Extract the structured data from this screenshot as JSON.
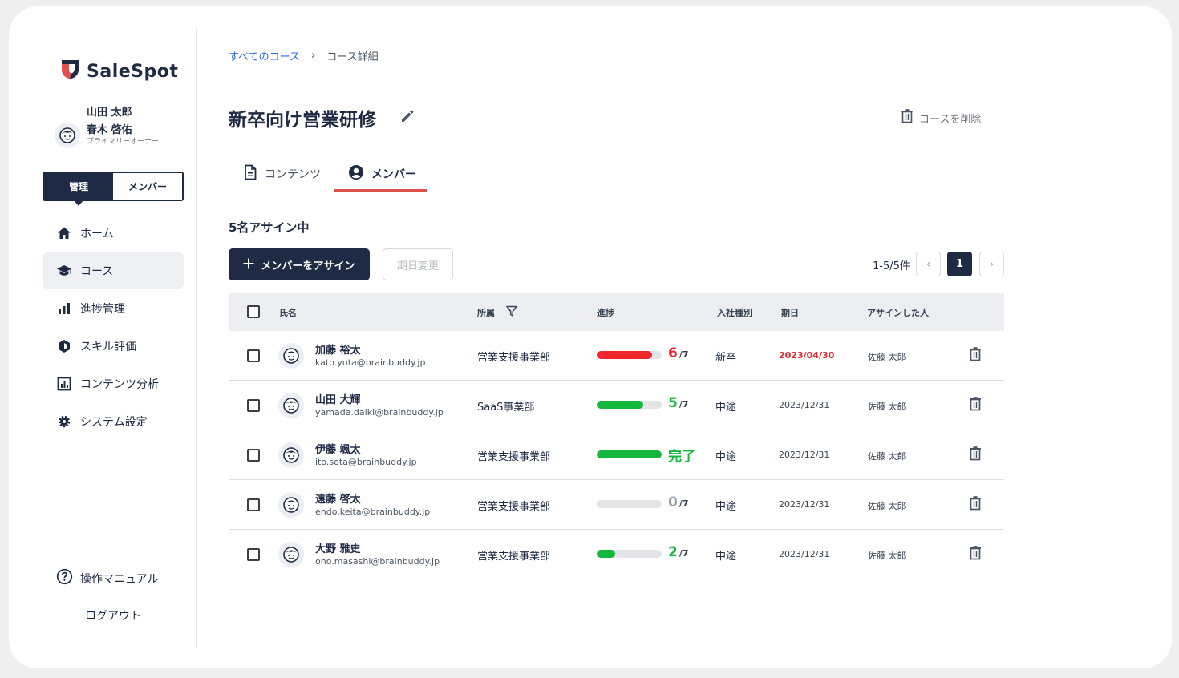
{
  "app": {
    "logo_text": "SaleSpot"
  },
  "sidebar": {
    "org_name": "山田 太郎",
    "user_name": "春木 啓佑",
    "user_role": "プライマリーオーナー",
    "role_toggle": {
      "admin": "管理",
      "member": "メンバー",
      "active": "admin"
    },
    "nav": [
      {
        "label": "ホーム",
        "icon": "home-icon"
      },
      {
        "label": "コース",
        "icon": "graduation-cap-icon",
        "active": true
      },
      {
        "label": "進捗管理",
        "icon": "bar-chart-icon"
      },
      {
        "label": "スキル評価",
        "icon": "skill-icon"
      },
      {
        "label": "コンテンツ分析",
        "icon": "analytics-icon"
      },
      {
        "label": "システム設定",
        "icon": "gear-icon"
      }
    ],
    "help_label": "操作マニュアル",
    "logout_label": "ログアウト"
  },
  "breadcrumb": {
    "link": "すべてのコース",
    "separator": "›",
    "current": "コース詳細"
  },
  "page": {
    "title": "新卒向け営業研修",
    "delete_label": "コースを削除"
  },
  "tabs": [
    {
      "label": "コンテンツ",
      "icon": "document-icon"
    },
    {
      "label": "メンバー",
      "icon": "user-circle-icon",
      "active": true
    }
  ],
  "members": {
    "assign_count": "5名アサイン中",
    "assign_button": "メンバーをアサイン",
    "change_date_button": "期日変更",
    "pager_label": "1-5/5件",
    "current_page": "1",
    "columns": {
      "name": "氏名",
      "dept": "所属",
      "progress": "進捗",
      "type": "入社種別",
      "due": "期日",
      "assigner": "アサインした人"
    },
    "rows": [
      {
        "name": "加藤 裕太",
        "email": "kato.yuta@brainbuddy.jp",
        "dept": "営業支援事業部",
        "done": "6",
        "total": "/7",
        "progress": 0.857,
        "status_color": "#f0262c",
        "type": "新卒",
        "due": "2023/04/30",
        "overdue": true,
        "assigner": "佐藤 太郎"
      },
      {
        "name": "山田 大輝",
        "email": "yamada.daiki@brainbuddy.jp",
        "dept": "SaaS事業部",
        "done": "5",
        "total": "/7",
        "progress": 0.714,
        "status_color": "#13b83a",
        "type": "中途",
        "due": "2023/12/31",
        "overdue": false,
        "assigner": "佐藤 太郎"
      },
      {
        "name": "伊藤 颯太",
        "email": "ito.sota@brainbuddy.jp",
        "dept": "営業支援事業部",
        "done": "完了",
        "total": "",
        "progress": 1.0,
        "status_color": "#13b83a",
        "type": "中途",
        "due": "2023/12/31",
        "overdue": false,
        "assigner": "佐藤 太郎"
      },
      {
        "name": "遠藤 啓太",
        "email": "endo.keita@brainbuddy.jp",
        "dept": "営業支援事業部",
        "done": "0",
        "total": "/7",
        "progress": 0.0,
        "status_color": "#9aa0aa",
        "type": "中途",
        "due": "2023/12/31",
        "overdue": false,
        "assigner": "佐藤 太郎"
      },
      {
        "name": "大野 雅史",
        "email": "ono.masashi@brainbuddy.jp",
        "dept": "営業支援事業部",
        "done": "2",
        "total": "/7",
        "progress": 0.286,
        "status_color": "#13b83a",
        "type": "中途",
        "due": "2023/12/31",
        "overdue": false,
        "assigner": "佐藤 太郎"
      }
    ]
  },
  "colors": {
    "primary": "#1f2a44",
    "accent": "#e0524f",
    "link": "#2f6ee5",
    "overdue": "#e0242c",
    "success": "#13b83a",
    "danger": "#f0262c"
  }
}
